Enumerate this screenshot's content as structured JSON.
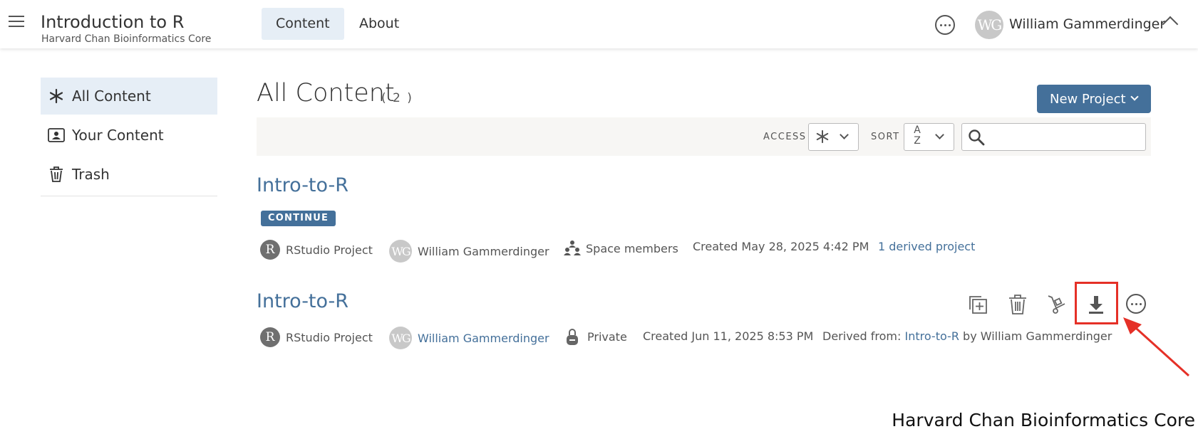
{
  "header": {
    "title": "Introduction to R",
    "subtitle": "Harvard Chan Bioinformatics Core",
    "tabs": [
      {
        "label": "Content"
      },
      {
        "label": "About"
      }
    ],
    "user": {
      "initials": "WG",
      "name": "William Gammerdinger"
    }
  },
  "sidebar": {
    "items": [
      {
        "label": "All Content",
        "icon": "asterisk-icon"
      },
      {
        "label": "Your Content",
        "icon": "user-card-icon"
      },
      {
        "label": "Trash",
        "icon": "trash-icon"
      }
    ]
  },
  "main": {
    "title": "All Content",
    "count": "( 2 )",
    "new_project_label": "New Project",
    "filters": {
      "access_label": "ACCESS",
      "sort_label": "SORT",
      "sort_value_top": "A",
      "sort_value_bottom": "Z",
      "search_placeholder": ""
    },
    "projects": [
      {
        "title": "Intro-to-R",
        "badge": "CONTINUE",
        "type": "RStudio Project",
        "type_letter": "R",
        "owner_initials": "WG",
        "owner": "William Gammerdinger",
        "access": "Space members",
        "created": "Created May 28, 2025 4:42 PM",
        "derived_link": "1 derived project"
      },
      {
        "title": "Intro-to-R",
        "type": "RStudio Project",
        "type_letter": "R",
        "owner_initials": "WG",
        "owner": "William Gammerdinger",
        "access": "Private",
        "created": "Created Jun 11, 2025 8:53 PM",
        "derived_prefix": "Derived from:",
        "derived_link": "Intro-to-R",
        "derived_suffix": "by William Gammerdinger",
        "actions": [
          "copy-icon",
          "trash-icon",
          "move-cart-icon",
          "download-icon",
          "more-icon"
        ]
      }
    ]
  },
  "annotation": {
    "highlight_color": "#e53027",
    "highlighted_action": "download-icon"
  },
  "footer": {
    "credit": "Harvard Chan Bioinformatics Core"
  },
  "colors": {
    "accent": "#44709a",
    "active_bg": "#e6eef6",
    "filterbar_bg": "#f7f6f4"
  }
}
